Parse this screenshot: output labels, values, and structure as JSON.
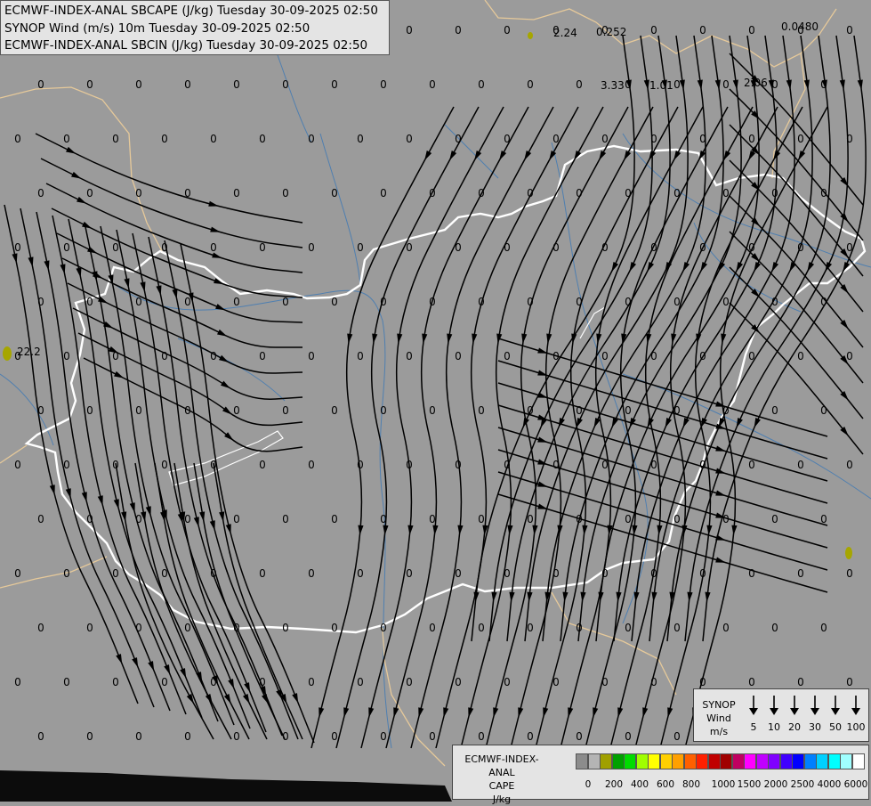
{
  "header": {
    "title_lines": [
      "ECMWF-INDEX-ANAL SBCAPE (J/kg) Tuesday 30-09-2025 02:50",
      "SYNOP Wind (m/s) 10m Tuesday 30-09-2025 02:50",
      "ECMWF-INDEX-ANAL SBCIN (J/kg) Tuesday 30-09-2025 02:50"
    ]
  },
  "map": {
    "background_color": "#9b9b9b",
    "country_border_color": "#ffffff",
    "neighbor_border_color": "#e6c99a",
    "river_color": "#4f7fb0",
    "streamline_color": "#000000",
    "cape_labels": [
      "2.24",
      "0.252",
      "3.33",
      "1.01",
      "2.06",
      "22.2",
      "0.0480"
    ],
    "zero_label": "0"
  },
  "wind_legend": {
    "title": "SYNOP Wind m/s",
    "items": [
      "5",
      "10",
      "20",
      "30",
      "50",
      "100"
    ]
  },
  "cape_legend": {
    "title": "ECMWF-INDEX-ANAL CAPE J/kg",
    "colors": [
      "#8c8c8c",
      "#b4b4b4",
      "#a0a000",
      "#00a000",
      "#00dc00",
      "#a0ff00",
      "#ffff00",
      "#ffd000",
      "#ffa000",
      "#ff6000",
      "#ff2000",
      "#c00000",
      "#a00000",
      "#c00060",
      "#ff00ff",
      "#c000ff",
      "#8000ff",
      "#4000ff",
      "#0000ff",
      "#0080ff",
      "#00d0ff",
      "#00ffff",
      "#a0ffff",
      "#ffffff"
    ],
    "ticks": [
      "0",
      "200",
      "400",
      "600",
      "800",
      "1000",
      "1500",
      "2000",
      "2500",
      "4000",
      "6000"
    ]
  }
}
